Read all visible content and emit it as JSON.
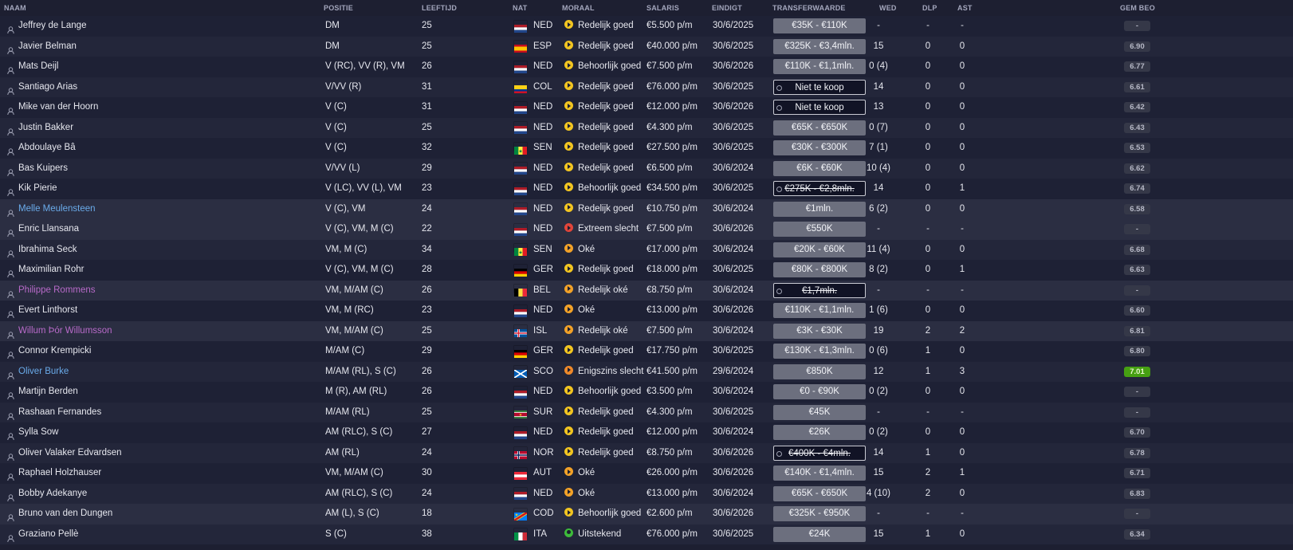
{
  "headers": {
    "naam": "NAAM",
    "positie": "POSITIE",
    "leeftijd": "LEEFTIJD",
    "nat": "NAT",
    "moraal": "MORAAL",
    "salaris": "SALARIS",
    "eindigt": "EINDIGT",
    "transferwaarde": "TRANSFERWAARDE",
    "wed": "WED",
    "dlp": "DLP",
    "ast": "AST",
    "gem_beo": "GEM BEO"
  },
  "colors": {
    "morale_good": "#f2c521",
    "morale_ok": "#f2a228",
    "morale_medium": "#ef8a2a",
    "morale_bad": "#e2453a",
    "morale_excellent": "#3dbb3a",
    "name_blue": "#6aabea",
    "name_purple": "#b86ac9",
    "rating_best": "#46a012"
  },
  "players": [
    {
      "name": "Jeffrey de Lange",
      "pos": "DM",
      "age": "25",
      "nat": "NED",
      "flag": "NED",
      "moral": "Redelijk goed",
      "moral_icon": "good",
      "salary": "€5.500 p/m",
      "ends": "30/6/2025",
      "tv": "€35K - €110K",
      "tv_style": "grey",
      "wed": "-",
      "dlp": "-",
      "ast": "-",
      "rating": "-"
    },
    {
      "name": "Javier Belman",
      "pos": "DM",
      "age": "25",
      "nat": "ESP",
      "flag": "ESP",
      "moral": "Redelijk goed",
      "moral_icon": "good",
      "salary": "€40.000 p/m",
      "ends": "30/6/2025",
      "tv": "€325K - €3,4mln.",
      "tv_style": "grey",
      "wed": "15",
      "dlp": "0",
      "ast": "0",
      "rating": "6.90"
    },
    {
      "name": "Mats Deijl",
      "pos": "V (RC), VV (R), VM",
      "age": "26",
      "nat": "NED",
      "flag": "NED",
      "moral": "Behoorlijk goed",
      "moral_icon": "good",
      "salary": "€7.500 p/m",
      "ends": "30/6/2026",
      "tv": "€110K - €1,1mln.",
      "tv_style": "grey",
      "wed": "0 (4)",
      "dlp": "0",
      "ast": "0",
      "rating": "6.77"
    },
    {
      "name": "Santiago Arias",
      "pos": "V/VV (R)",
      "age": "31",
      "nat": "COL",
      "flag": "COL",
      "moral": "Redelijk goed",
      "moral_icon": "good",
      "salary": "€76.000 p/m",
      "ends": "30/6/2025",
      "tv": "Niet te koop",
      "tv_style": "out",
      "wed": "14",
      "dlp": "0",
      "ast": "0",
      "rating": "6.61"
    },
    {
      "name": "Mike van der Hoorn",
      "pos": "V (C)",
      "age": "31",
      "nat": "NED",
      "flag": "NED",
      "moral": "Redelijk goed",
      "moral_icon": "good",
      "salary": "€12.000 p/m",
      "ends": "30/6/2026",
      "tv": "Niet te koop",
      "tv_style": "out",
      "wed": "13",
      "dlp": "0",
      "ast": "0",
      "rating": "6.42"
    },
    {
      "name": "Justin Bakker",
      "pos": "V (C)",
      "age": "25",
      "nat": "NED",
      "flag": "NED",
      "moral": "Redelijk goed",
      "moral_icon": "good",
      "salary": "€4.300 p/m",
      "ends": "30/6/2025",
      "tv": "€65K - €650K",
      "tv_style": "grey",
      "wed": "0 (7)",
      "dlp": "0",
      "ast": "0",
      "rating": "6.43"
    },
    {
      "name": "Abdoulaye Bâ",
      "pos": "V (C)",
      "age": "32",
      "nat": "SEN",
      "flag": "SEN",
      "moral": "Redelijk goed",
      "moral_icon": "good",
      "salary": "€27.500 p/m",
      "ends": "30/6/2025",
      "tv": "€30K - €300K",
      "tv_style": "grey",
      "wed": "7 (1)",
      "dlp": "0",
      "ast": "0",
      "rating": "6.53"
    },
    {
      "name": "Bas Kuipers",
      "pos": "V/VV (L)",
      "age": "29",
      "nat": "NED",
      "flag": "NED",
      "moral": "Redelijk goed",
      "moral_icon": "good",
      "salary": "€6.500 p/m",
      "ends": "30/6/2024",
      "tv": "€6K - €60K",
      "tv_style": "grey",
      "wed": "10 (4)",
      "dlp": "0",
      "ast": "0",
      "rating": "6.62"
    },
    {
      "name": "Kik Pierie",
      "pos": "V (LC), VV (L), VM",
      "age": "23",
      "nat": "NED",
      "flag": "NED",
      "moral": "Behoorlijk goed",
      "moral_icon": "good",
      "salary": "€34.500 p/m",
      "ends": "30/6/2025",
      "tv": "€275K - €2,8mln.",
      "tv_style": "out-strike",
      "wed": "14",
      "dlp": "0",
      "ast": "1",
      "rating": "6.74"
    },
    {
      "name": "Melle Meulensteen",
      "name_color": "blue",
      "pos": "V (C), VM",
      "age": "24",
      "nat": "NED",
      "flag": "NED",
      "moral": "Redelijk goed",
      "moral_icon": "good",
      "salary": "€10.750 p/m",
      "ends": "30/6/2024",
      "tv": "€1mln.",
      "tv_style": "grey",
      "wed": "6 (2)",
      "dlp": "0",
      "ast": "0",
      "rating": "6.58",
      "highlight": true
    },
    {
      "name": "Enric Llansana",
      "pos": "V (C), VM, M (C)",
      "age": "22",
      "nat": "NED",
      "flag": "NED",
      "moral": "Extreem slecht",
      "moral_icon": "bad",
      "salary": "€7.500 p/m",
      "ends": "30/6/2026",
      "tv": "€550K",
      "tv_style": "grey",
      "wed": "-",
      "dlp": "-",
      "ast": "-",
      "rating": "-",
      "highlight": true
    },
    {
      "name": "Ibrahima Seck",
      "pos": "VM, M (C)",
      "age": "34",
      "nat": "SEN",
      "flag": "SEN",
      "moral": "Oké",
      "moral_icon": "ok",
      "salary": "€17.000 p/m",
      "ends": "30/6/2024",
      "tv": "€20K - €60K",
      "tv_style": "grey",
      "wed": "11 (4)",
      "dlp": "0",
      "ast": "0",
      "rating": "6.68"
    },
    {
      "name": "Maximilian Rohr",
      "pos": "V (C), VM, M (C)",
      "age": "28",
      "nat": "GER",
      "flag": "GER",
      "moral": "Redelijk goed",
      "moral_icon": "good",
      "salary": "€18.000 p/m",
      "ends": "30/6/2025",
      "tv": "€80K - €800K",
      "tv_style": "grey",
      "wed": "8 (2)",
      "dlp": "0",
      "ast": "1",
      "rating": "6.63"
    },
    {
      "name": "Philippe Rommens",
      "name_color": "purple",
      "pos": "VM, M/AM (C)",
      "age": "26",
      "nat": "BEL",
      "flag": "BEL",
      "moral": "Redelijk oké",
      "moral_icon": "ok",
      "salary": "€8.750 p/m",
      "ends": "30/6/2024",
      "tv": "€1,7mln.",
      "tv_style": "out-strike",
      "wed": "-",
      "dlp": "-",
      "ast": "-",
      "rating": "-",
      "highlight": true
    },
    {
      "name": "Evert Linthorst",
      "pos": "VM, M (RC)",
      "age": "23",
      "nat": "NED",
      "flag": "NED",
      "moral": "Oké",
      "moral_icon": "ok",
      "salary": "€13.000 p/m",
      "ends": "30/6/2026",
      "tv": "€110K - €1,1mln.",
      "tv_style": "grey",
      "wed": "1 (6)",
      "dlp": "0",
      "ast": "0",
      "rating": "6.60"
    },
    {
      "name": "Willum Þór Willumsson",
      "name_color": "purple",
      "pos": "VM, M/AM (C)",
      "age": "25",
      "nat": "ISL",
      "flag": "ISL",
      "moral": "Redelijk oké",
      "moral_icon": "ok",
      "salary": "€7.500 p/m",
      "ends": "30/6/2024",
      "tv": "€3K - €30K",
      "tv_style": "grey",
      "wed": "19",
      "dlp": "2",
      "ast": "2",
      "rating": "6.81",
      "highlight": true
    },
    {
      "name": "Connor Krempicki",
      "pos": "M/AM (C)",
      "age": "29",
      "nat": "GER",
      "flag": "GER",
      "moral": "Redelijk goed",
      "moral_icon": "good",
      "salary": "€17.750 p/m",
      "ends": "30/6/2025",
      "tv": "€130K - €1,3mln.",
      "tv_style": "grey",
      "wed": "0 (6)",
      "dlp": "1",
      "ast": "0",
      "rating": "6.80"
    },
    {
      "name": "Oliver Burke",
      "name_color": "blue",
      "pos": "M/AM (RL), S (C)",
      "age": "26",
      "nat": "SCO",
      "flag": "SCO",
      "moral": "Enigszins slecht",
      "moral_icon": "medium",
      "salary": "€41.500 p/m",
      "ends": "29/6/2024",
      "tv": "€850K",
      "tv_style": "grey",
      "wed": "12",
      "dlp": "1",
      "ast": "3",
      "rating": "7.01",
      "rating_best": true
    },
    {
      "name": "Martijn Berden",
      "pos": "M (R), AM (RL)",
      "age": "26",
      "nat": "NED",
      "flag": "NED",
      "moral": "Behoorlijk goed",
      "moral_icon": "good",
      "salary": "€3.500 p/m",
      "ends": "30/6/2024",
      "tv": "€0 - €90K",
      "tv_style": "grey",
      "wed": "0 (2)",
      "dlp": "0",
      "ast": "0",
      "rating": "-"
    },
    {
      "name": "Rashaan Fernandes",
      "pos": "M/AM (RL)",
      "age": "25",
      "nat": "SUR",
      "flag": "SUR",
      "moral": "Redelijk goed",
      "moral_icon": "good",
      "salary": "€4.300 p/m",
      "ends": "30/6/2025",
      "tv": "€45K",
      "tv_style": "grey",
      "wed": "-",
      "dlp": "-",
      "ast": "-",
      "rating": "-"
    },
    {
      "name": "Sylla Sow",
      "pos": "AM (RLC), S (C)",
      "age": "27",
      "nat": "NED",
      "flag": "NED",
      "moral": "Redelijk goed",
      "moral_icon": "good",
      "salary": "€12.000 p/m",
      "ends": "30/6/2024",
      "tv": "€26K",
      "tv_style": "grey",
      "wed": "0 (2)",
      "dlp": "0",
      "ast": "0",
      "rating": "6.70"
    },
    {
      "name": "Oliver Valaker Edvardsen",
      "pos": "AM (RL)",
      "age": "24",
      "nat": "NOR",
      "flag": "NOR",
      "moral": "Redelijk goed",
      "moral_icon": "good",
      "salary": "€8.750 p/m",
      "ends": "30/6/2026",
      "tv": "€400K - €4mln.",
      "tv_style": "out-strike",
      "wed": "14",
      "dlp": "1",
      "ast": "0",
      "rating": "6.78"
    },
    {
      "name": "Raphael Holzhauser",
      "pos": "VM, M/AM (C)",
      "age": "30",
      "nat": "AUT",
      "flag": "AUT",
      "moral": "Oké",
      "moral_icon": "ok",
      "salary": "€26.000 p/m",
      "ends": "30/6/2026",
      "tv": "€140K - €1,4mln.",
      "tv_style": "grey",
      "wed": "15",
      "dlp": "2",
      "ast": "1",
      "rating": "6.71"
    },
    {
      "name": "Bobby Adekanye",
      "pos": "AM (RLC), S (C)",
      "age": "24",
      "nat": "NED",
      "flag": "NED",
      "moral": "Oké",
      "moral_icon": "ok",
      "salary": "€13.000 p/m",
      "ends": "30/6/2024",
      "tv": "€65K - €650K",
      "tv_style": "grey",
      "wed": "4 (10)",
      "dlp": "2",
      "ast": "0",
      "rating": "6.83"
    },
    {
      "name": "Bruno van den Dungen",
      "pos": "AM (L), S (C)",
      "age": "18",
      "nat": "COD",
      "flag": "COD",
      "moral": "Behoorlijk goed",
      "moral_icon": "good",
      "salary": "€2.600 p/m",
      "ends": "30/6/2026",
      "tv": "€325K - €950K",
      "tv_style": "grey",
      "wed": "-",
      "dlp": "-",
      "ast": "-",
      "rating": "-",
      "highlight": true
    },
    {
      "name": "Graziano Pellè",
      "pos": "S (C)",
      "age": "38",
      "nat": "ITA",
      "flag": "ITA",
      "moral": "Uitstekend",
      "moral_icon": "excellent",
      "salary": "€76.000 p/m",
      "ends": "30/6/2025",
      "tv": "€24K",
      "tv_style": "grey",
      "wed": "15",
      "dlp": "1",
      "ast": "0",
      "rating": "6.34"
    }
  ]
}
